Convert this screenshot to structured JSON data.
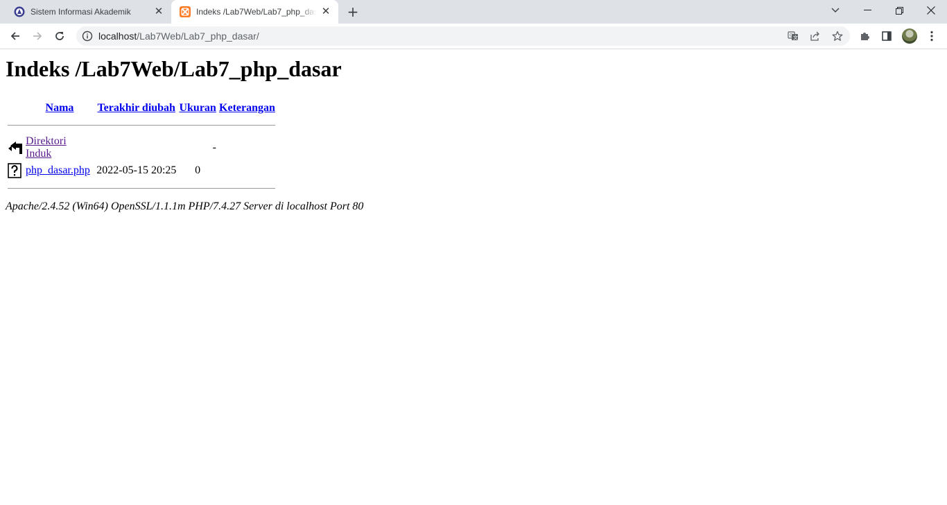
{
  "browser": {
    "tabs": [
      {
        "title": "Sistem Informasi Akademik",
        "active": false
      },
      {
        "title": "Indeks /Lab7Web/Lab7_php_dasar",
        "active": true
      }
    ],
    "address_bar": {
      "host": "localhost",
      "path": "/Lab7Web/Lab7_php_dasar/"
    },
    "icons": {
      "back": "arrow-left-icon",
      "forward": "arrow-right-icon",
      "reload": "reload-icon",
      "info": "info-icon",
      "translate": "translate-icon",
      "share": "share-icon",
      "bookmark": "star-icon",
      "extensions": "puzzle-icon",
      "side_panel": "side-panel-icon",
      "menu": "kebab-menu-icon"
    }
  },
  "page": {
    "heading": "Indeks /Lab7Web/Lab7_php_dasar",
    "columns": [
      "Nama",
      "Terakhir diubah",
      "Ukuran",
      "Keterangan"
    ],
    "rows": [
      {
        "icon": "back-folder-icon",
        "name": "Direktori Induk",
        "modified": "",
        "size": "-",
        "description": ""
      },
      {
        "icon": "unknown-file-icon",
        "name": "php_dasar.php",
        "modified": "2022-05-15 20:25",
        "size": "0",
        "description": ""
      }
    ],
    "footer": "Apache/2.4.52 (Win64) OpenSSL/1.1.1m PHP/7.4.27 Server di localhost Port 80"
  },
  "colors": {
    "link": "#0000ee",
    "visited_link": "#551a8b",
    "tab_strip": "#dee1e6",
    "omnibox": "#f1f3f4"
  }
}
